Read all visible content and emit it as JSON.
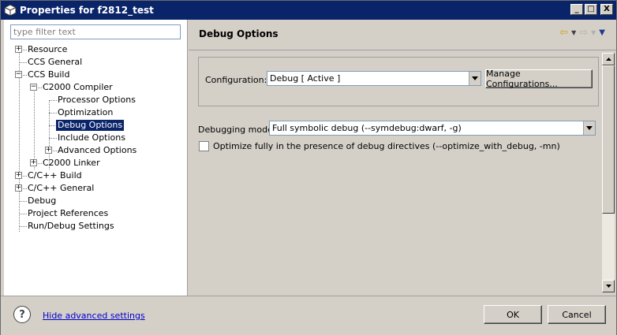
{
  "window": {
    "title": "Properties for f2812_test",
    "minimize_glyph": "_",
    "maximize_glyph": "□",
    "close_glyph": "X"
  },
  "filter": {
    "placeholder": "type filter text"
  },
  "tree": {
    "items": [
      {
        "label": "Resource"
      },
      {
        "label": "CCS General"
      },
      {
        "label": "CCS Build"
      },
      {
        "label": "C2000 Compiler"
      },
      {
        "label": "Processor Options"
      },
      {
        "label": "Optimization"
      },
      {
        "label": "Debug Options"
      },
      {
        "label": "Include Options"
      },
      {
        "label": "Advanced Options"
      },
      {
        "label": "C2000 Linker"
      },
      {
        "label": "C/C++ Build"
      },
      {
        "label": "C/C++ General"
      },
      {
        "label": "Debug"
      },
      {
        "label": "Project References"
      },
      {
        "label": "Run/Debug Settings"
      }
    ],
    "selected": "Debug Options"
  },
  "page": {
    "title": "Debug Options",
    "back_icon": "⇦",
    "forward_icon": "⇨",
    "menu_icon": "▼"
  },
  "configuration": {
    "label": "Configuration:",
    "value": "Debug  [ Active ]",
    "manage_button": "Manage Configurations..."
  },
  "debugging_model": {
    "label": "Debugging model",
    "value": "Full symbolic debug (--symdebug:dwarf, -g)"
  },
  "optimize_checkbox": {
    "label": "Optimize fully in the presence of debug directives (--optimize_with_debug, -mn)",
    "checked": false
  },
  "footer": {
    "help_glyph": "?",
    "link": "Hide advanced settings",
    "ok": "OK",
    "cancel": "Cancel"
  },
  "colors": {
    "title_bar": "#0a246a",
    "selection": "#0a246a",
    "link": "#0000cc",
    "face": "#d4d0c8"
  }
}
